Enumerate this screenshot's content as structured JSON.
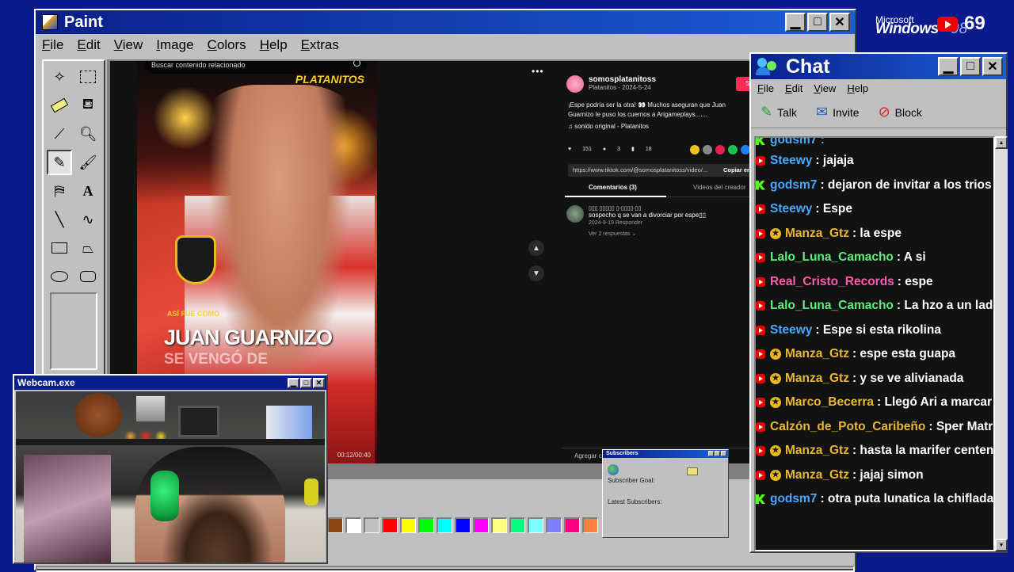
{
  "desktop": {
    "logo_microsoft": "Microsoft",
    "logo_windows": "Windows",
    "logo_version": "98",
    "subscriber_count": "69"
  },
  "paint": {
    "title": "Paint",
    "menu": [
      "File",
      "Edit",
      "View",
      "Image",
      "Colors",
      "Help",
      "Extras"
    ],
    "palette": [
      "#8b4513",
      "#ffffff",
      "#c0c0c0",
      "#ff0000",
      "#ffff00",
      "#00ff00",
      "#00ffff",
      "#0000ff",
      "#ff00ff",
      "#ffff80",
      "#00ff80",
      "#80ffff",
      "#8080ff",
      "#ff0080",
      "#ff8040"
    ]
  },
  "video": {
    "search_placeholder": "Buscar contenido relacionado",
    "brand": "PLATANITOS",
    "caption_small": "ASÍ FUE COMO",
    "caption_big": "JUAN GUARNIZO",
    "caption_sub": "SE VENGÓ DE",
    "timer": "00:12/00:40"
  },
  "tiktok": {
    "username": "somosplatanitoss",
    "meta": "Platanitos · 2024-5-24",
    "follow": "Seg",
    "description": "¡Espe podría ser la otra! 👀 Muchos aseguran que Juan Guarnizo le puso los cuernos a Arigameplays.......",
    "sound": "♫  sonido original - Platanitos",
    "likes": "151",
    "comments": "3",
    "saves": "18",
    "link": "https://www.tiktok.com/@somosplatanitoss/video/...",
    "copy_link": "Copiar en",
    "tab_comments": "Comentarios (3)",
    "tab_creator": "Videos del creador",
    "comment_name": "▯▯▯ ▯▯▯▯▯ ▯-▯▯▯▯-▯▯",
    "comment_text": "sospecho q se van a divorciar por espe▯▯",
    "comment_meta": "2024-9-19     Responder",
    "comment_replies": "Ver 2 respuestas ⌄",
    "add_comment": "Agregar come"
  },
  "subscribers_widget": {
    "title": "Subscribers",
    "goal_label": "Subscriber Goal:",
    "latest_label": "Latest Subscribers:"
  },
  "webcam": {
    "title": "Webcam.exe"
  },
  "chat": {
    "title": "Chat",
    "menu": [
      "File",
      "Edit",
      "View",
      "Help"
    ],
    "tools": {
      "talk": "Talk",
      "invite": "Invite",
      "block": "Block"
    },
    "partial_top": "godsm7 :",
    "messages": [
      {
        "platform": "yt",
        "member": false,
        "user": "Steewy",
        "color": "#4aa8ff",
        "text": ": jajaja"
      },
      {
        "platform": "kick",
        "member": false,
        "user": "godsm7",
        "color": "#4aa8ff",
        "text": ": dejaron de invitar a los trios a pre"
      },
      {
        "platform": "yt",
        "member": false,
        "user": "Steewy",
        "color": "#4aa8ff",
        "text": ": Espe"
      },
      {
        "platform": "yt",
        "member": true,
        "user": "Manza_Gtz",
        "color": "#e8b830",
        "text": ": la espe"
      },
      {
        "platform": "yt",
        "member": false,
        "user": "Lalo_Luna_Camacho",
        "color": "#5af07a",
        "text": ": A si"
      },
      {
        "platform": "yt",
        "member": false,
        "user": "Real_Cristo_Records",
        "color": "#ff5ab0",
        "text": ": espe"
      },
      {
        "platform": "yt",
        "member": false,
        "user": "Lalo_Luna_Camacho",
        "color": "#5af07a",
        "text": ": La hzo a un lado jaja"
      },
      {
        "platform": "yt",
        "member": false,
        "user": "Steewy",
        "color": "#4aa8ff",
        "text": ": Espe si esta rikolina"
      },
      {
        "platform": "yt",
        "member": true,
        "user": "Manza_Gtz",
        "color": "#e8b830",
        "text": ": espe esta guapa"
      },
      {
        "platform": "yt",
        "member": true,
        "user": "Manza_Gtz",
        "color": "#e8b830",
        "text": ": y se ve alivianada"
      },
      {
        "platform": "yt",
        "member": true,
        "user": "Marco_Becerra",
        "color": "#e8b830",
        "text": ": Llegó Ari a marcar su g"
      },
      {
        "platform": "yt",
        "member": false,
        "user": "Calzón_de_Poto_Caribeño",
        "color": "#e8b830",
        "text": ": Sper Matrago"
      },
      {
        "platform": "yt",
        "member": true,
        "user": "Manza_Gtz",
        "color": "#e8b830",
        "text": ": hasta la marifer centeno sa"
      },
      {
        "platform": "yt",
        "member": true,
        "user": "Manza_Gtz",
        "color": "#e8b830",
        "text": ": jajaj simon"
      },
      {
        "platform": "kick",
        "member": false,
        "user": "godsm7",
        "color": "#4aa8ff",
        "text": ": otra puta lunatica la chiflada cen"
      }
    ]
  }
}
